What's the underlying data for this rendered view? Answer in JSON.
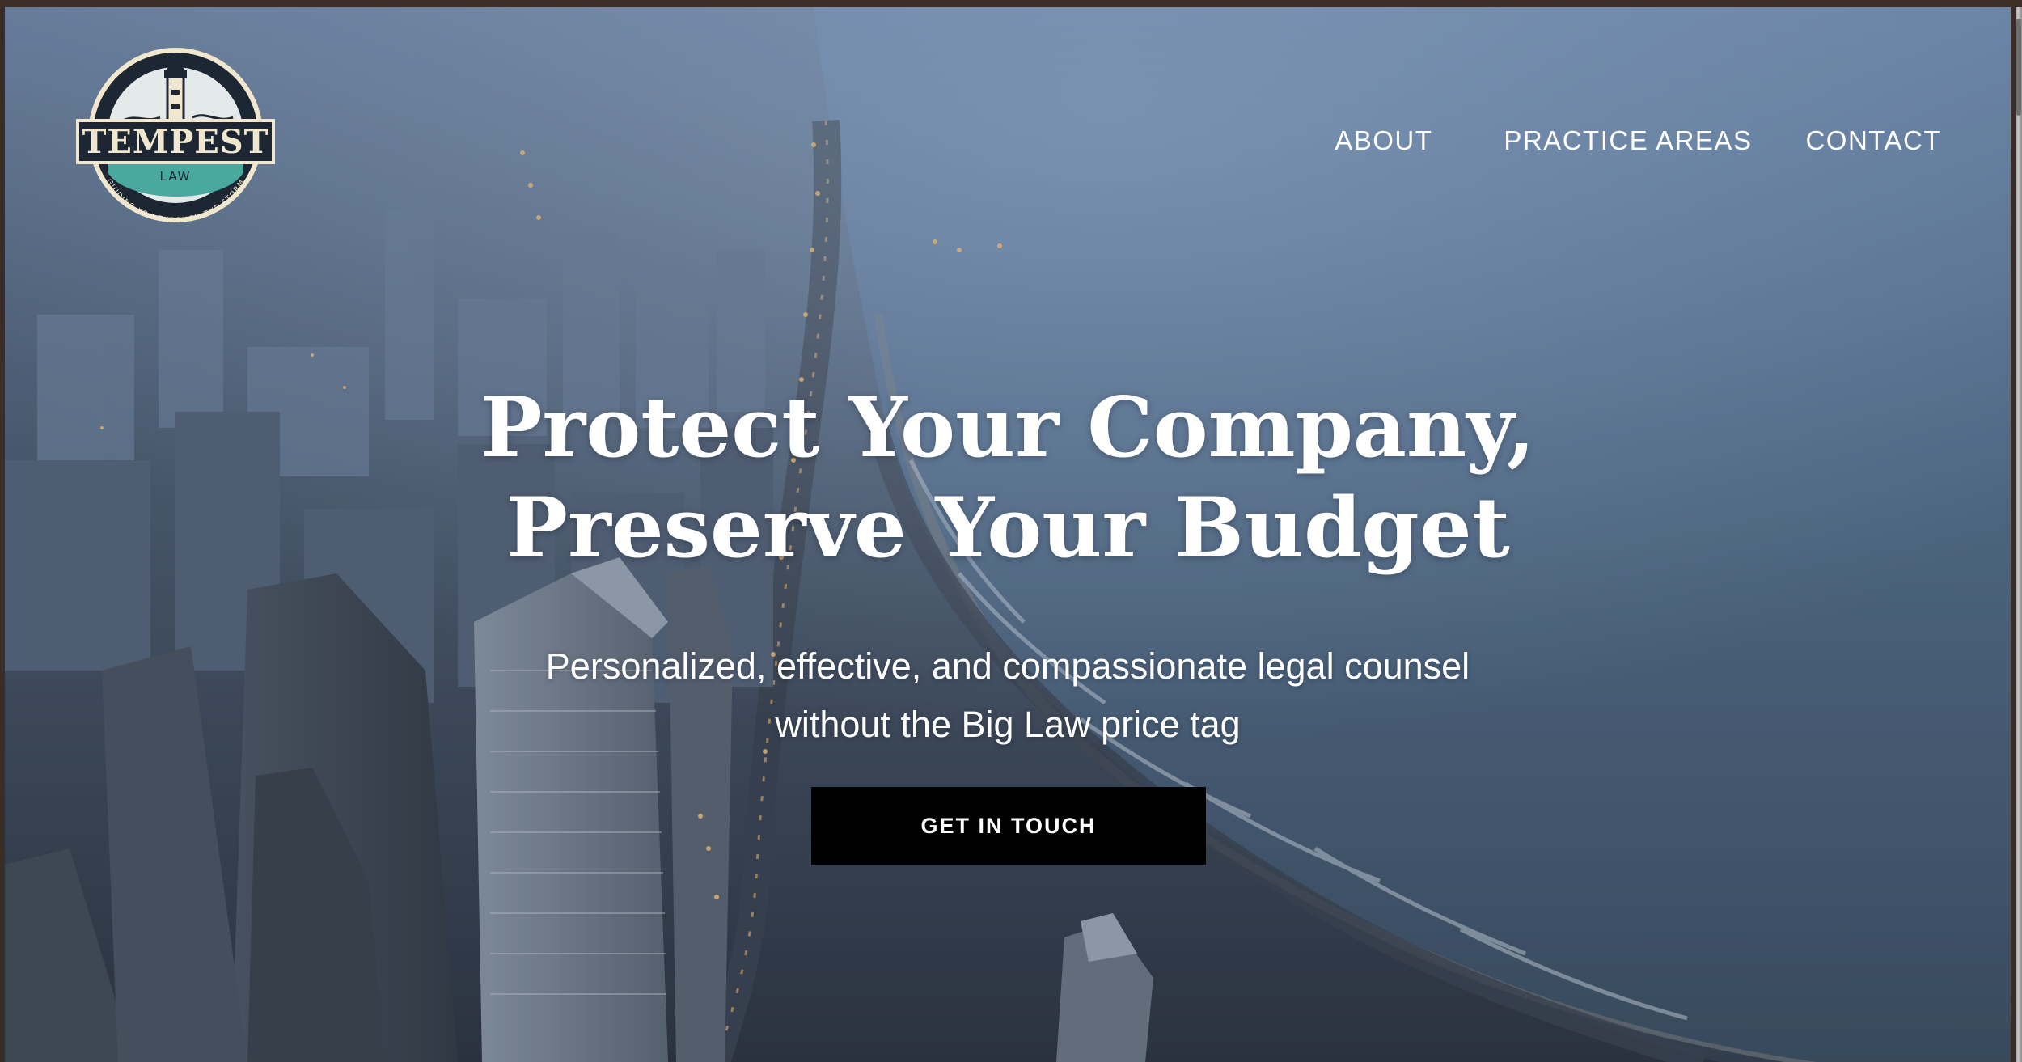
{
  "brand": {
    "name": "TEMPEST",
    "sub": "LAW",
    "tagline": "GUIDING YOU THROUGH THE STORM",
    "colors": {
      "navy": "#1c2733",
      "teal": "#4aa99f",
      "cream": "#f1e7cf"
    }
  },
  "nav": {
    "items": [
      "ABOUT",
      "PRACTICE AREAS",
      "CONTACT"
    ]
  },
  "hero": {
    "headline": [
      "Protect Your Company,",
      "Preserve Your Budget"
    ],
    "subhead": [
      "Personalized, effective, and compassionate legal counsel",
      "without the Big Law price tag"
    ],
    "cta_label": "GET IN TOUCH",
    "background_image": "aerial-city-lakefront-photo"
  }
}
